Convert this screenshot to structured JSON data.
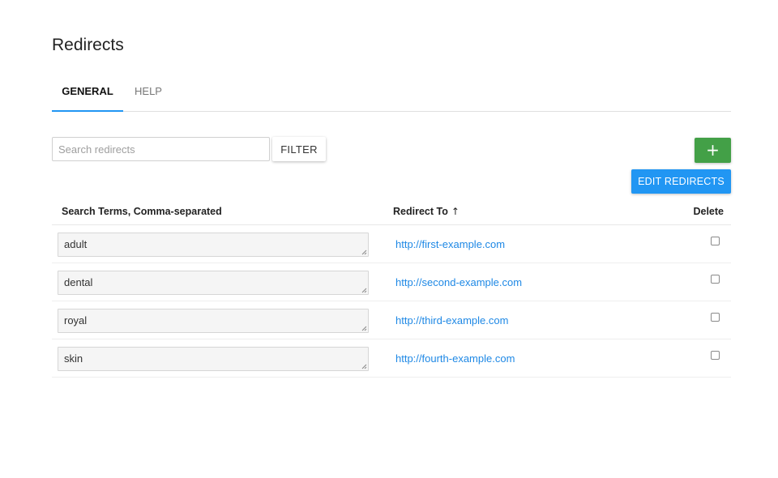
{
  "page": {
    "title": "Redirects"
  },
  "tabs": [
    {
      "label": "GENERAL"
    },
    {
      "label": "HELP"
    }
  ],
  "toolbar": {
    "search_placeholder": "Search redirects",
    "search_value": "",
    "filter_label": "FILTER",
    "add_label": "+",
    "edit_label": "EDIT REDIRECTS"
  },
  "table": {
    "headers": {
      "terms": "Search Terms, Comma-separated",
      "redirect": "Redirect To",
      "redirect_sort": "↑",
      "delete": "Delete"
    },
    "rows": [
      {
        "term": "adult",
        "url": "http://first-example.com"
      },
      {
        "term": "dental",
        "url": "http://second-example.com"
      },
      {
        "term": "royal",
        "url": "http://third-example.com"
      },
      {
        "term": "skin",
        "url": "http://fourth-example.com"
      }
    ]
  },
  "colors": {
    "accent_blue": "#2196f3",
    "add_green": "#43a047",
    "link_blue": "#1e88e5"
  }
}
